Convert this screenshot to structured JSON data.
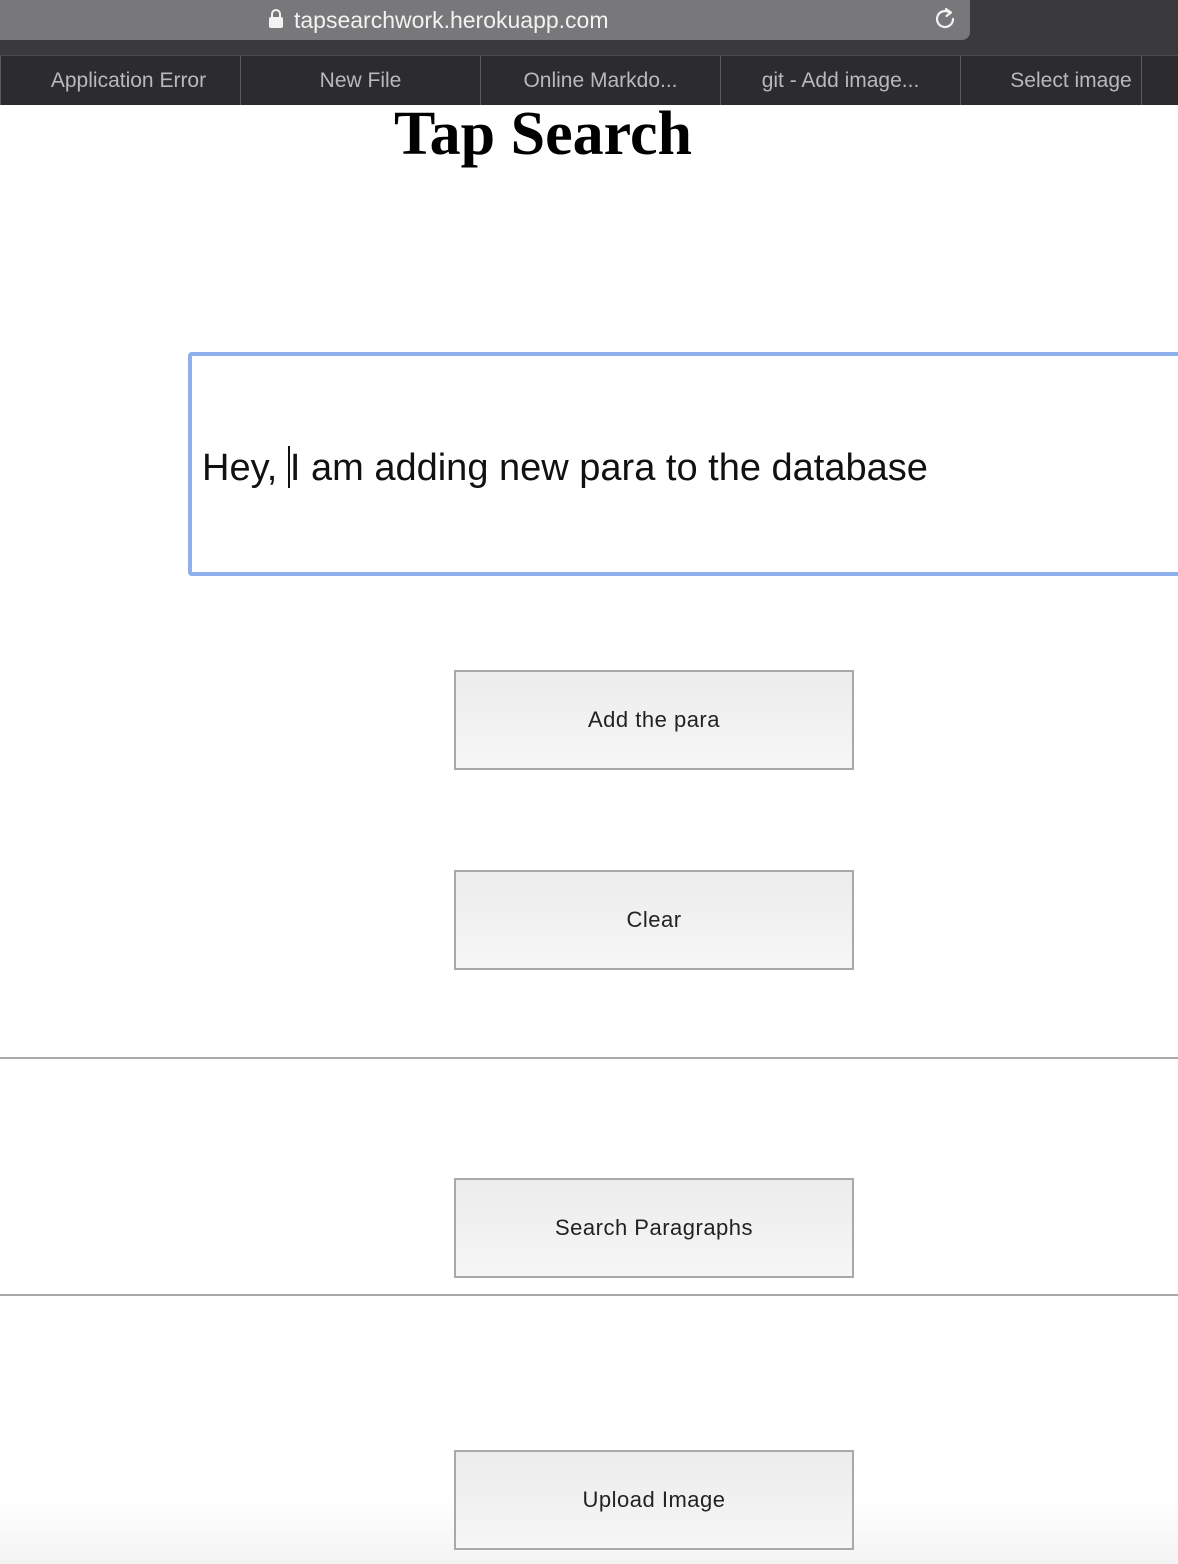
{
  "browser": {
    "url": "tapsearchwork.herokuapp.com",
    "tabs": [
      {
        "label": "Application Error"
      },
      {
        "label": "New File"
      },
      {
        "label": "Online Markdo..."
      },
      {
        "label": "git - Add image..."
      },
      {
        "label": "Select image"
      }
    ]
  },
  "page": {
    "title": "Tap Search",
    "paragraph_input": {
      "value_before_caret": "Hey, ",
      "value_after_caret": "I am adding new para to the database"
    },
    "buttons": {
      "add_para": "Add the para",
      "clear": "Clear",
      "search_paragraphs": "Search Paragraphs",
      "upload_image": "Upload Image"
    }
  },
  "icons": {
    "lock": "lock-icon",
    "reload": "reload-icon"
  },
  "colors": {
    "input_focus_border": "#8fb0ea",
    "chrome_bg": "#3a3a3c",
    "address_bar_bg": "#78787a"
  }
}
